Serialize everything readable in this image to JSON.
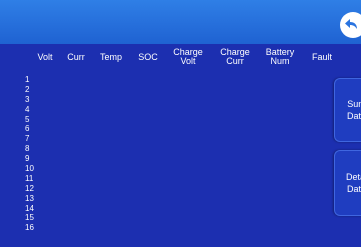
{
  "header": {
    "columns": [
      "Volt",
      "Curr",
      "Temp",
      "SOC",
      "Charge\nVolt",
      "Charge\nCurr",
      "Battery\nNum",
      "Fault"
    ]
  },
  "rows": [
    "1",
    "2",
    "3",
    "4",
    "5",
    "6",
    "7",
    "8",
    "9",
    "10",
    "11",
    "12",
    "13",
    "14",
    "15",
    "16"
  ],
  "side_buttons": {
    "summary_label": "Sum\nData",
    "detail_label": "Detai\nData"
  },
  "colors": {
    "background": "#1c2fb0",
    "topbar": "#2a74e0",
    "text": "#ffffff"
  },
  "icons": {
    "back": "back-arrow-icon"
  }
}
